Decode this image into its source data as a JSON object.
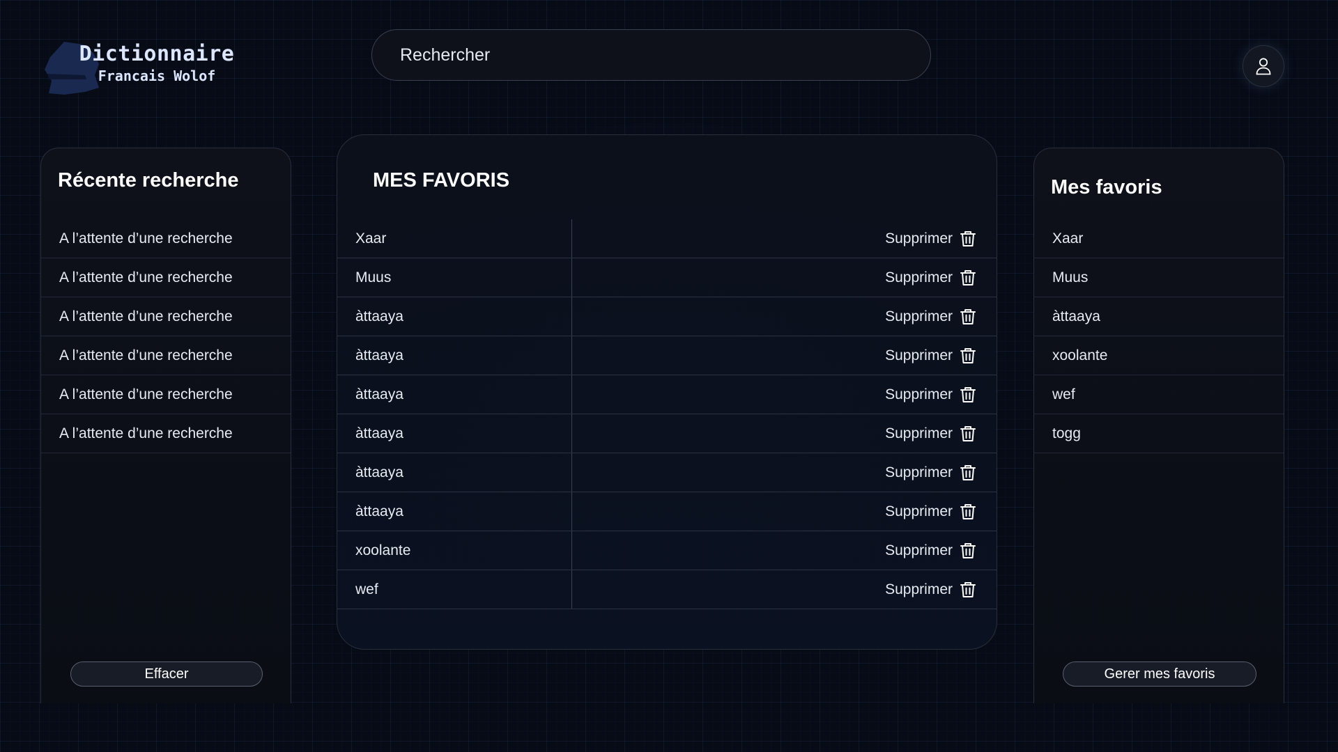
{
  "app": {
    "title": "Dictionnaire",
    "subtitle": "Francais Wolof"
  },
  "search": {
    "placeholder": "Rechercher"
  },
  "recent": {
    "title": "Récente recherche",
    "items": [
      "A l’attente d’une recherche",
      "A l’attente d’une recherche",
      "A l’attente d’une recherche",
      "A l’attente d’une recherche",
      "A l’attente d’une recherche",
      "A l’attente d’une recherche"
    ],
    "clear_label": "Effacer"
  },
  "favorites_table": {
    "title": "MES FAVORIS",
    "delete_label": "Supprimer",
    "rows": [
      "Xaar",
      "Muus",
      "àttaaya",
      "àttaaya",
      "àttaaya",
      "àttaaya",
      "àttaaya",
      "àttaaya",
      "xoolante",
      "wef"
    ]
  },
  "favorites_side": {
    "title": "Mes favoris",
    "items": [
      "Xaar",
      "Muus",
      "àttaaya",
      "xoolante",
      "wef",
      "togg"
    ],
    "manage_label": "Gerer mes favoris"
  },
  "icons": {
    "logo": "senegal-map-icon",
    "avatar": "user-icon",
    "delete": "trash-icon"
  },
  "colors": {
    "background": "#070b16",
    "panel": "#0e111a",
    "text": "#ffffff",
    "logo_text": "#dce6ff"
  }
}
